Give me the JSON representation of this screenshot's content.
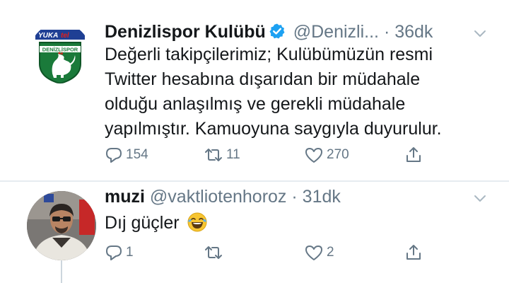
{
  "tweets": [
    {
      "author": "Denizlispor Kulübü",
      "handle": "@Denizli...",
      "dot": "·",
      "time": "36dk",
      "verified": true,
      "avatar_text": "DENİZLİSPOR",
      "avatar_sponsor": "YUKA tel",
      "text_lines": [
        "Değerli takipçilerimiz; Kulübümüzün resmi",
        "Twitter hesabına dışarıdan bir müdahale",
        "olduğu anlaşılmış ve gerekli müdahale",
        "yapılmıştır. Kamuoyuna saygıyla duyurulur."
      ],
      "replies": "154",
      "retweets": "11",
      "likes": "270"
    },
    {
      "author": "muzi",
      "handle": "@vaktliotenhoroz",
      "dot": "·",
      "time": "31dk",
      "verified": false,
      "text": "Dıj güçler",
      "emoji": "😂",
      "replies": "1",
      "retweets": "",
      "likes": "2"
    }
  ],
  "colors": {
    "text": "#14171a",
    "muted": "#657786",
    "verified": "#1da1f2",
    "club_green": "#1a7a3a"
  },
  "icons": [
    "verified-badge-icon",
    "chevron-down-icon",
    "reply-icon",
    "retweet-icon",
    "like-icon",
    "share-icon"
  ]
}
